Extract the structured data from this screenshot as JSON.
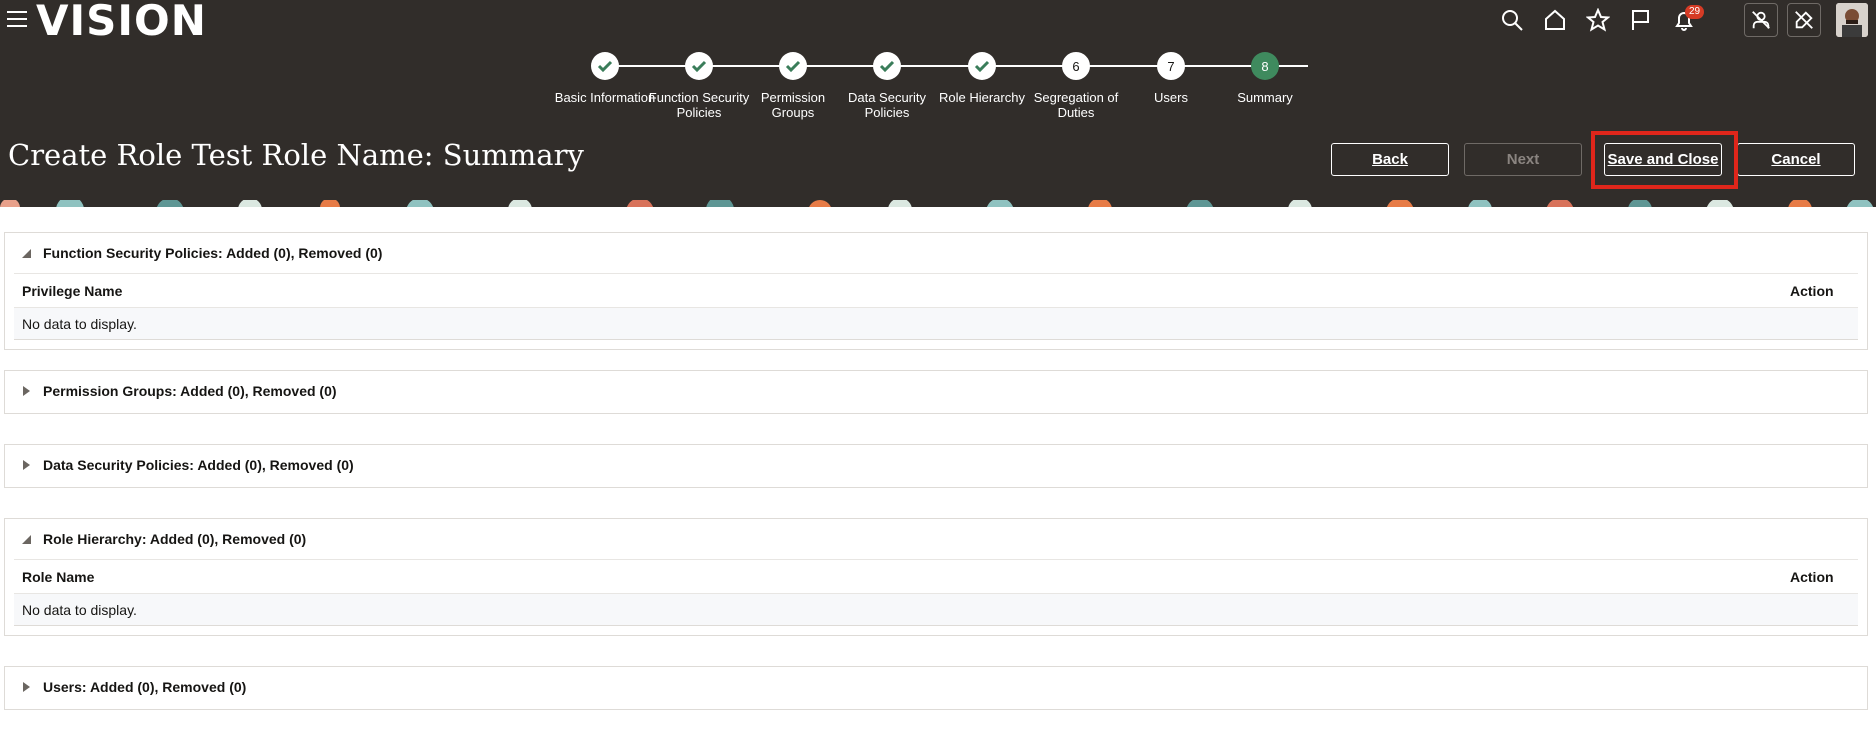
{
  "app": {
    "logo": "VISION",
    "notifications_count": "29"
  },
  "train": {
    "steps": [
      {
        "label": "Basic Information",
        "status": "done"
      },
      {
        "label": "Function Security Policies",
        "status": "done"
      },
      {
        "label": "Permission Groups",
        "status": "done"
      },
      {
        "label": "Data Security Policies",
        "status": "done"
      },
      {
        "label": "Role Hierarchy",
        "status": "done"
      },
      {
        "label": "Segregation of Duties",
        "status": "6"
      },
      {
        "label": "Users",
        "status": "7"
      },
      {
        "label": "Summary",
        "status": "8"
      }
    ]
  },
  "page": {
    "title": "Create Role Test Role Name: Summary"
  },
  "buttons": {
    "back": "Back",
    "next": "Next",
    "save_close": "Save and Close",
    "cancel": "Cancel"
  },
  "sections": {
    "function_security": {
      "title": "Function Security Policies: Added (0), Removed (0)",
      "col1": "Privilege Name",
      "col2": "Action",
      "empty": "No data to display."
    },
    "permission_groups": {
      "title": "Permission Groups: Added (0), Removed (0)"
    },
    "data_security": {
      "title": "Data Security Policies: Added (0), Removed (0)"
    },
    "role_hierarchy": {
      "title": "Role Hierarchy: Added (0), Removed (0)",
      "col1": "Role Name",
      "col2": "Action",
      "empty": "No data to display."
    },
    "users": {
      "title": "Users: Added (0), Removed (0)"
    }
  },
  "colors": {
    "header_bg": "#312d2a",
    "current_step": "#3f8a5e",
    "highlight": "#e0261b"
  }
}
